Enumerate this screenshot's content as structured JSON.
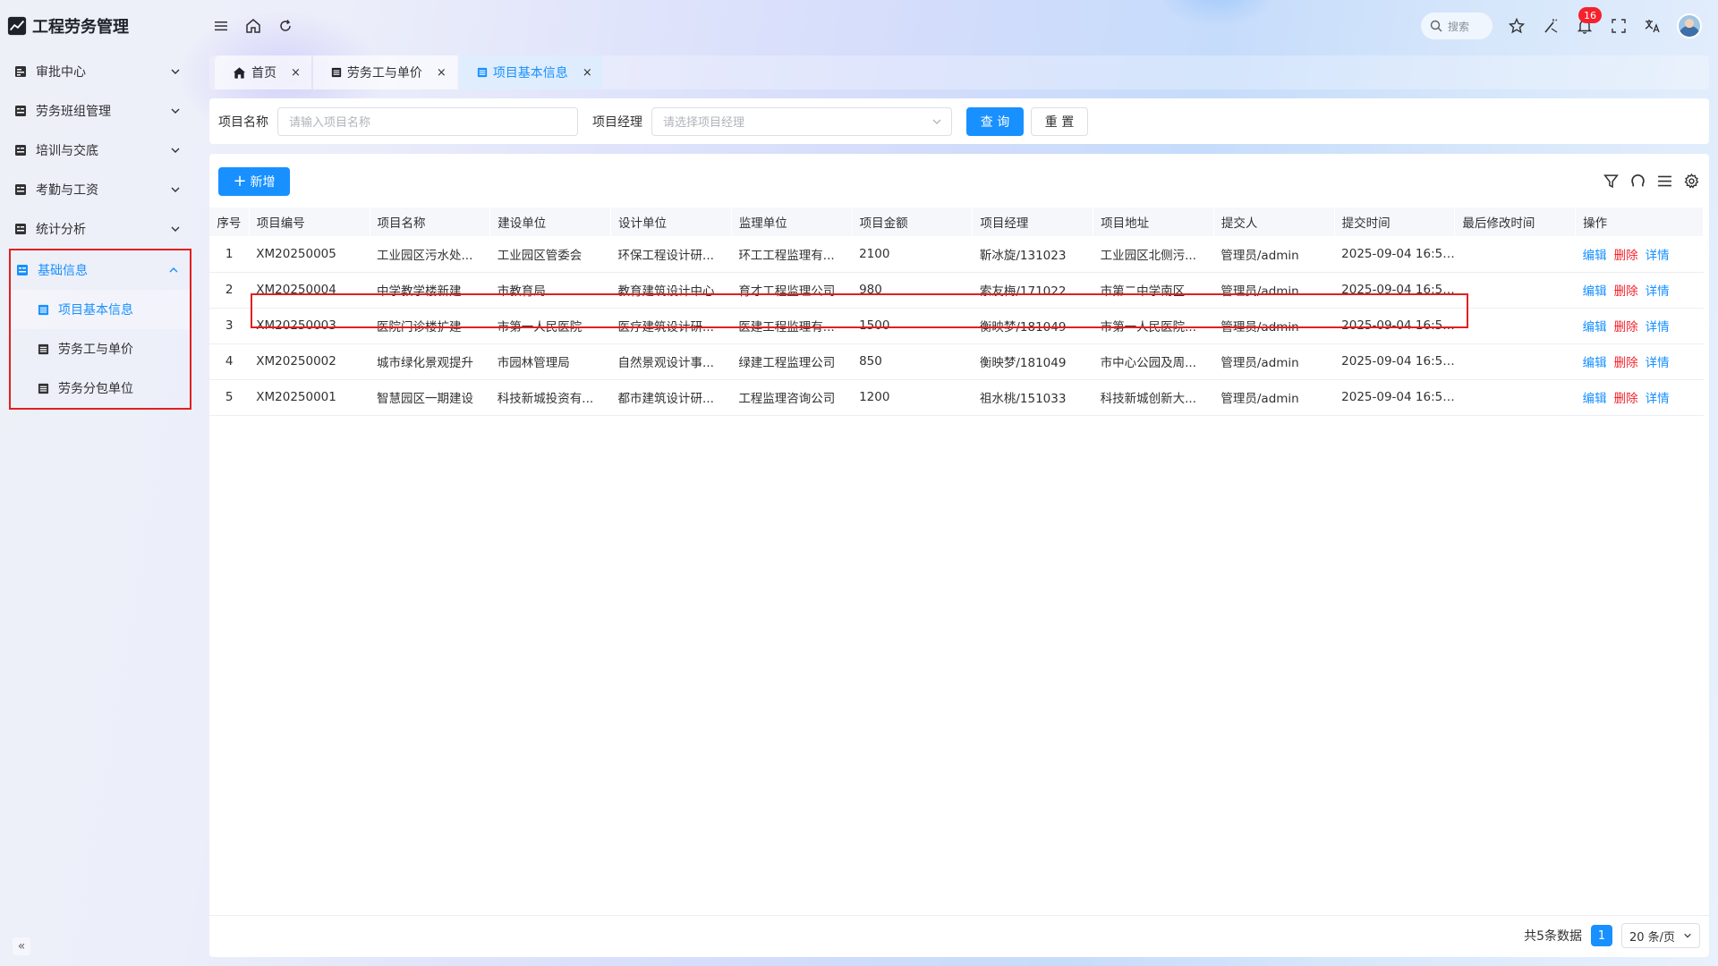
{
  "app": {
    "title": "工程劳务管理"
  },
  "sidebar": {
    "items": [
      {
        "label": "审批中心",
        "icon": "approval-icon"
      },
      {
        "label": "劳务班组管理",
        "icon": "team-icon"
      },
      {
        "label": "培训与交底",
        "icon": "training-icon"
      },
      {
        "label": "考勤与工资",
        "icon": "attendance-icon"
      },
      {
        "label": "统计分析",
        "icon": "stats-icon"
      }
    ],
    "group": {
      "label": "基础信息",
      "children": [
        {
          "label": "项目基本信息",
          "active": true
        },
        {
          "label": "劳务工与单价",
          "active": false
        },
        {
          "label": "劳务分包单位",
          "active": false
        }
      ]
    },
    "collapse_glyph": "«"
  },
  "header": {
    "search_label": "搜索",
    "notification_count": "16"
  },
  "tabs": [
    {
      "label": "首页",
      "icon": "home-icon"
    },
    {
      "label": "劳务工与单价",
      "icon": "doc-icon"
    },
    {
      "label": "项目基本信息",
      "icon": "doc-icon",
      "active": true
    }
  ],
  "filter": {
    "name_label": "项目名称",
    "name_placeholder": "请输入项目名称",
    "manager_label": "项目经理",
    "manager_placeholder": "请选择项目经理",
    "query_label": "查 询",
    "reset_label": "重 置"
  },
  "toolbar": {
    "add_label": "新增"
  },
  "table": {
    "columns": [
      "序号",
      "项目编号",
      "项目名称",
      "建设单位",
      "设计单位",
      "监理单位",
      "项目金额",
      "项目经理",
      "项目地址",
      "提交人",
      "提交时间",
      "最后修改时间",
      "操作"
    ],
    "actions": {
      "edit": "编辑",
      "delete": "删除",
      "detail": "详情"
    },
    "rows": [
      {
        "idx": "1",
        "code": "XM20250005",
        "name": "工业园区污水处...",
        "builder": "工业园区管委会",
        "designer": "环保工程设计研...",
        "supervisor": "环工工程监理有...",
        "amount": "2100",
        "manager": "靳冰旋/131023",
        "address": "工业园区北侧污...",
        "submitter": "管理员/admin",
        "submit_time": "2025-09-04 16:55...",
        "modified": ""
      },
      {
        "idx": "2",
        "code": "XM20250004",
        "name": "中学教学楼新建",
        "builder": "市教育局",
        "designer": "教育建筑设计中心",
        "supervisor": "育才工程监理公司",
        "amount": "980",
        "manager": "索友梅/171022",
        "address": "市第二中学南区",
        "submitter": "管理员/admin",
        "submit_time": "2025-09-04 16:54...",
        "modified": ""
      },
      {
        "idx": "3",
        "code": "XM20250003",
        "name": "医院门诊楼扩建",
        "builder": "市第一人民医院",
        "designer": "医疗建筑设计研...",
        "supervisor": "医建工程监理有...",
        "amount": "1500",
        "manager": "衡映梦/181049",
        "address": "市第一人民医院...",
        "submitter": "管理员/admin",
        "submit_time": "2025-09-04 16:54...",
        "modified": ""
      },
      {
        "idx": "4",
        "code": "XM20250002",
        "name": "城市绿化景观提升",
        "builder": "市园林管理局",
        "designer": "自然景观设计事...",
        "supervisor": "绿建工程监理公司",
        "amount": "850",
        "manager": "衡映梦/181049",
        "address": "市中心公园及周...",
        "submitter": "管理员/admin",
        "submit_time": "2025-09-04 16:53...",
        "modified": ""
      },
      {
        "idx": "5",
        "code": "XM20250001",
        "name": "智慧园区一期建设",
        "builder": "科技新城投资有...",
        "designer": "都市建筑设计研...",
        "supervisor": "工程监理咨询公司",
        "amount": "1200",
        "manager": "祖水桃/151033",
        "address": "科技新城创新大...",
        "submitter": "管理员/admin",
        "submit_time": "2025-09-04 16:53...",
        "modified": ""
      }
    ]
  },
  "pagination": {
    "total_text": "共5条数据",
    "current_page": "1",
    "page_size": "20 条/页"
  },
  "colors": {
    "accent": "#1890ff",
    "danger": "#f5222d",
    "highlight": "#e02020"
  }
}
